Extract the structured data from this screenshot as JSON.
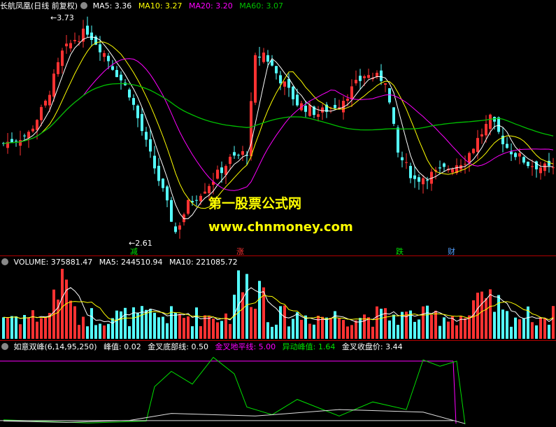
{
  "header_price": {
    "stock": "长航凤凰(日线 前复权)",
    "ma5": "MA5: 3.36",
    "ma10": "MA10: 3.27",
    "ma20": "MA20: 3.20",
    "ma60": "MA60: 3.07"
  },
  "header_volume": {
    "volume": "VOLUME: 375881.47",
    "ma5": "MA5: 244510.94",
    "ma10": "MA10: 221085.72"
  },
  "header_indicator": {
    "name": "如意双峰(6,14,95,250)",
    "peak": "峰值: 0.02",
    "gold_bottom": "金叉底部线: 0.50",
    "gold_horizon": "金叉地平线: 5.00",
    "abnormal_peak": "异动峰值: 1.64",
    "gold_close": "金叉收盘价: 3.44"
  },
  "price_labels": {
    "high": "3.73",
    "low": "2.61"
  },
  "event_tags": [
    "减",
    "涨",
    "跌",
    "财"
  ],
  "watermark": {
    "line1": "第一股票公式网",
    "line2": "www.chnmoney.com"
  },
  "colors": {
    "background": "#000000",
    "up": "#ff3232",
    "down": "#54ffff",
    "ma5": "#ffffff",
    "ma10": "#ffff00",
    "ma20": "#ff00ff",
    "ma60": "#00c000",
    "divider": "#b00000",
    "indicator_magenta": "#ff00ff",
    "indicator_green": "#00e000",
    "indicator_white": "#e0e0e0"
  },
  "chart_data": {
    "type": "candlestick",
    "price_high": 3.73,
    "price_low": 2.61,
    "indicator_levels": {
      "gold_horizon": 5.0,
      "gold_bottom": 0.5
    }
  }
}
